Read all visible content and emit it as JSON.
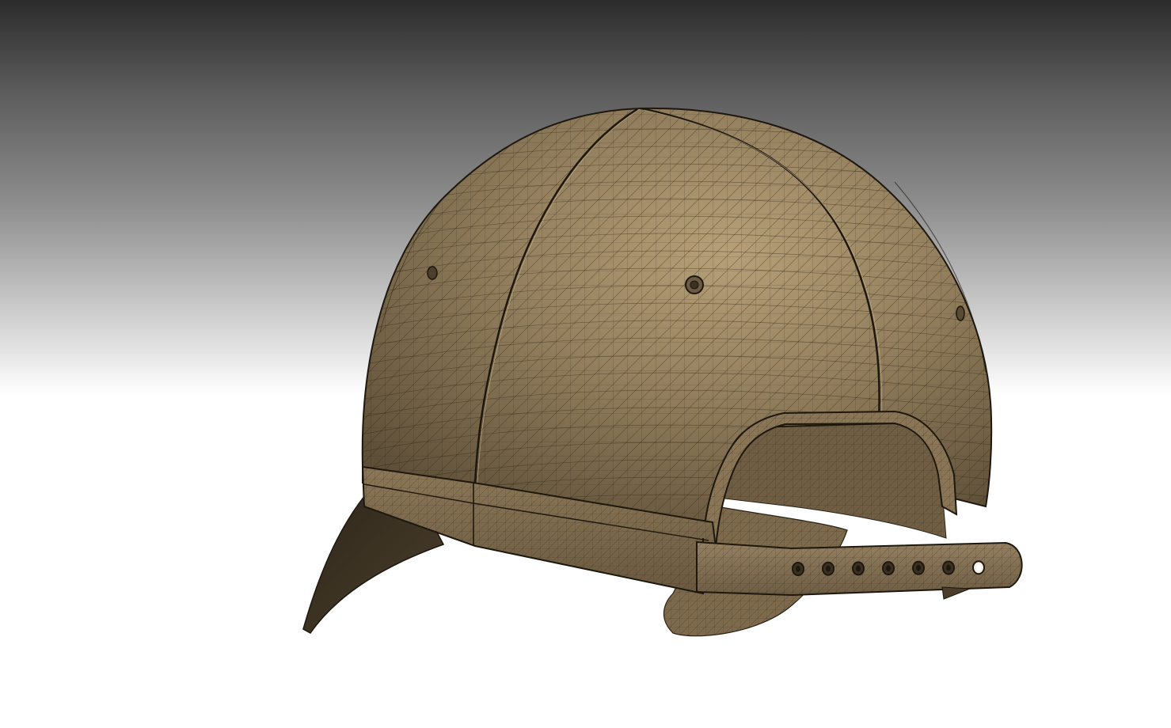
{
  "scene": {
    "subject": "baseball-cap-wireframe-model",
    "colors": {
      "bg_top": "#2b2b2b",
      "bg_mid": "#8e8e8e",
      "bg_bottom": "#ffffff",
      "cap_fill": "#8a7656",
      "cap_highlight": "#b29c74",
      "cap_shadow": "#5e4f38",
      "wire": "#2a2216",
      "visor": "#3b3122"
    },
    "strap_holes": 7,
    "eyelets": 3
  }
}
